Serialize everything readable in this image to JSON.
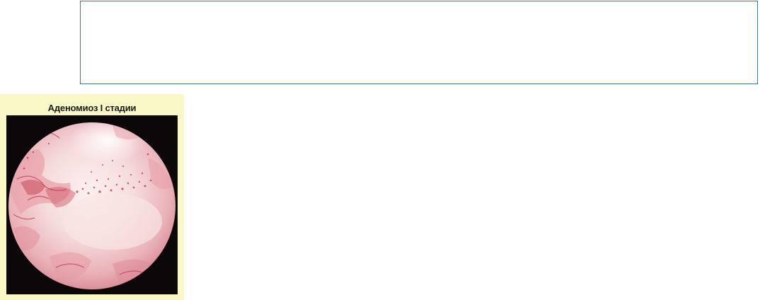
{
  "figure": {
    "caption": "Аденомиоз I стадии",
    "image_description_icon": "endoscopy-photo",
    "colors": {
      "panel_background": "#fbf8c8",
      "frame_background": "#0c0809",
      "tissue_base": "#f4d3d4",
      "vessel_red": "#c23a4b"
    }
  },
  "top_box": {
    "border_color": "#4a7a92"
  }
}
